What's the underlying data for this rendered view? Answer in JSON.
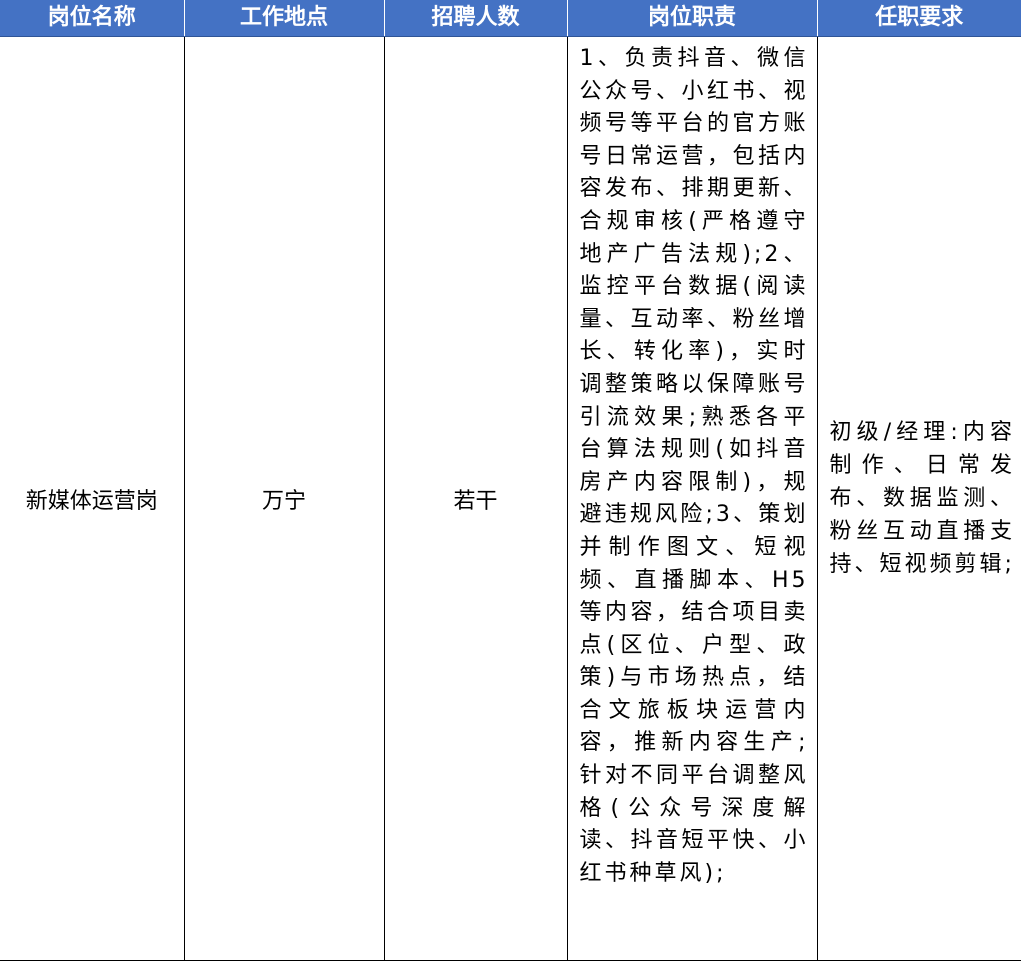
{
  "table": {
    "headers": [
      "岗位名称",
      "工作地点",
      "招聘人数",
      "岗位职责",
      "任职要求"
    ],
    "rows": [
      {
        "position": "新媒体运营岗",
        "location": "万宁",
        "headcount": "若干",
        "duties": "1、负责抖音、微信公众号、小红书、视频号等平台的官方账号日常运营，包括内容发布、排期更新、合规审核(严格遵守地产广告法规);2、监控平台数据(阅读量、互动率、粉丝增长、转化率)，实时调整策略以保障账号引流效果;熟悉各平台算法规则(如抖音房产内容限制)，规避违规风险;3、策划并制作图文、短视频、直播脚本、H5等内容，结合项目卖点(区位、户型、政策)与市场热点，结合文旅板块运营内容，推新内容生产;针对不同平台调整风格(公众号深度解读、抖音短平快、小红书种草风);",
        "requirements": "初级/经理:内容制作、日常发布、数据监测、粉丝互动直播支持、短视频剪辑;"
      }
    ]
  }
}
